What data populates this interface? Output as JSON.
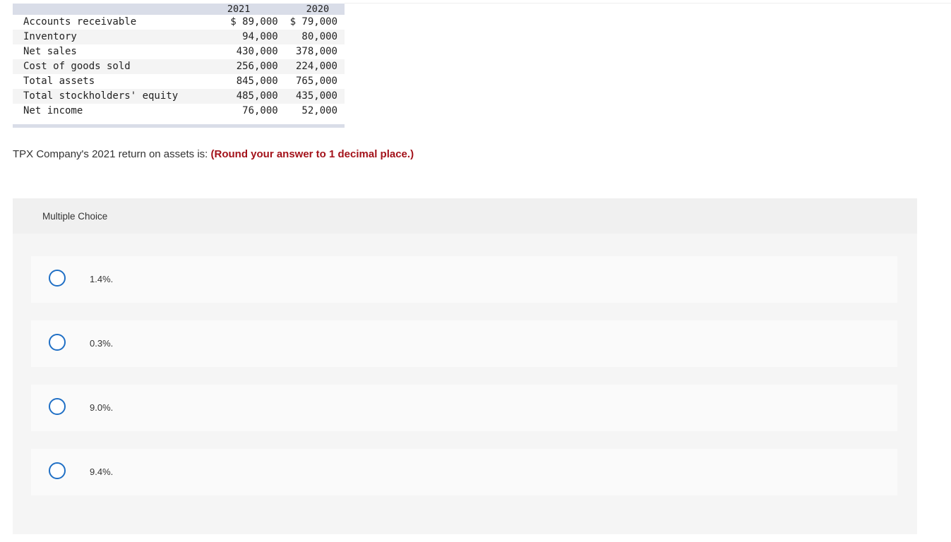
{
  "table": {
    "headers": [
      "",
      "2021",
      "2020"
    ],
    "rows": [
      {
        "label": "Accounts receivable",
        "y2021": "$ 89,000",
        "y2020": "$ 79,000"
      },
      {
        "label": "Inventory",
        "y2021": "94,000",
        "y2020": "80,000"
      },
      {
        "label": "Net sales",
        "y2021": "430,000",
        "y2020": "378,000"
      },
      {
        "label": "Cost of goods sold",
        "y2021": "256,000",
        "y2020": "224,000"
      },
      {
        "label": "Total assets",
        "y2021": "845,000",
        "y2020": "765,000"
      },
      {
        "label": "Total stockholders' equity",
        "y2021": "485,000",
        "y2020": "435,000"
      },
      {
        "label": "Net income",
        "y2021": "76,000",
        "y2020": "52,000"
      }
    ]
  },
  "question": {
    "text": "TPX Company's 2021 return on assets is: ",
    "hint": "(Round your answer to 1 decimal place.)"
  },
  "multiple_choice": {
    "title": "Multiple Choice",
    "options": [
      {
        "label": "1.4%."
      },
      {
        "label": "0.3%."
      },
      {
        "label": "9.0%."
      },
      {
        "label": "9.4%."
      }
    ]
  },
  "colors": {
    "header_band": "#d9dde8",
    "hint_red": "#a3121a",
    "radio_blue": "#1f6fc5"
  }
}
